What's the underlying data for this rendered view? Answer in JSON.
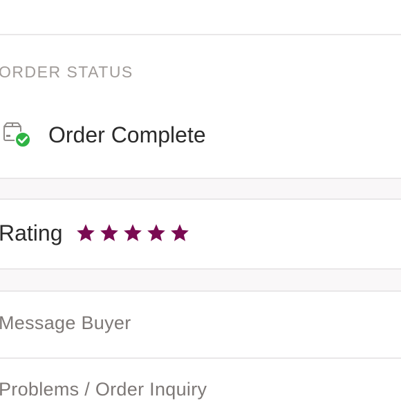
{
  "order_status": {
    "section_label": "ORDER STATUS",
    "status_text": "Order Complete",
    "status_icon": "package-check-icon"
  },
  "rating": {
    "label": "Rating",
    "value": 5,
    "max": 5,
    "star_color": "#7a0a52"
  },
  "actions": {
    "message_buyer": "Message Buyer",
    "problems_inquiry": "Problems / Order Inquiry"
  },
  "colors": {
    "accent": "#7a0a52",
    "success": "#2fb344",
    "divider": "#e9e7e8",
    "band": "#f9f7f8"
  }
}
